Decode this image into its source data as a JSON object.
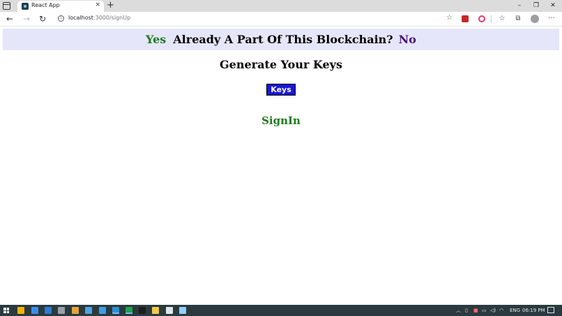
{
  "browser": {
    "tab_title": "React App",
    "tab_close": "×",
    "new_tab": "+",
    "url_host": "localhost",
    "url_path": ":3000/signUp",
    "window_controls": {
      "minimize": "–",
      "restore": "❐",
      "close": "✕"
    },
    "toolbar_icons": {
      "back": "←",
      "forward": "→",
      "refresh": "↻",
      "favorites": "☆",
      "collections": "⧉",
      "more": "···"
    }
  },
  "banner": {
    "yes_label": "Yes",
    "question": "Already A Part Of This Blockchain?",
    "no_label": "No",
    "bg_color": "#e6e6fa",
    "yes_color": "#1e7b1e",
    "no_color": "#4b0f7d"
  },
  "main": {
    "heading": "Generate Your Keys",
    "keys_button": "Keys",
    "keys_button_color": "#1a16d6",
    "signin_link": "SignIn"
  },
  "taskbar": {
    "language": "ENG",
    "time": "06:19 PM",
    "apps": [
      {
        "name": "task-view-icon",
        "color": "#f4b400"
      },
      {
        "name": "mail-icon",
        "color": "#3a8ee6"
      },
      {
        "name": "word-icon",
        "color": "#2b7cd3"
      },
      {
        "name": "feather-icon",
        "color": "#9aa0a6"
      },
      {
        "name": "chrome-icon",
        "color": "#e8a33c"
      },
      {
        "name": "document-icon",
        "color": "#4fa3e0"
      },
      {
        "name": "vscode-icon",
        "color": "#3c9ee8"
      },
      {
        "name": "edge-icon",
        "color": "#2d8fd6"
      },
      {
        "name": "app-green-icon",
        "color": "#1fa34a"
      },
      {
        "name": "terminal-icon",
        "color": "#1e1e1e"
      },
      {
        "name": "file-explorer-icon",
        "color": "#f2c94c"
      },
      {
        "name": "app-window-icon",
        "color": "#dfe6ea"
      },
      {
        "name": "app-blue-icon",
        "color": "#8fd0ff"
      }
    ]
  }
}
